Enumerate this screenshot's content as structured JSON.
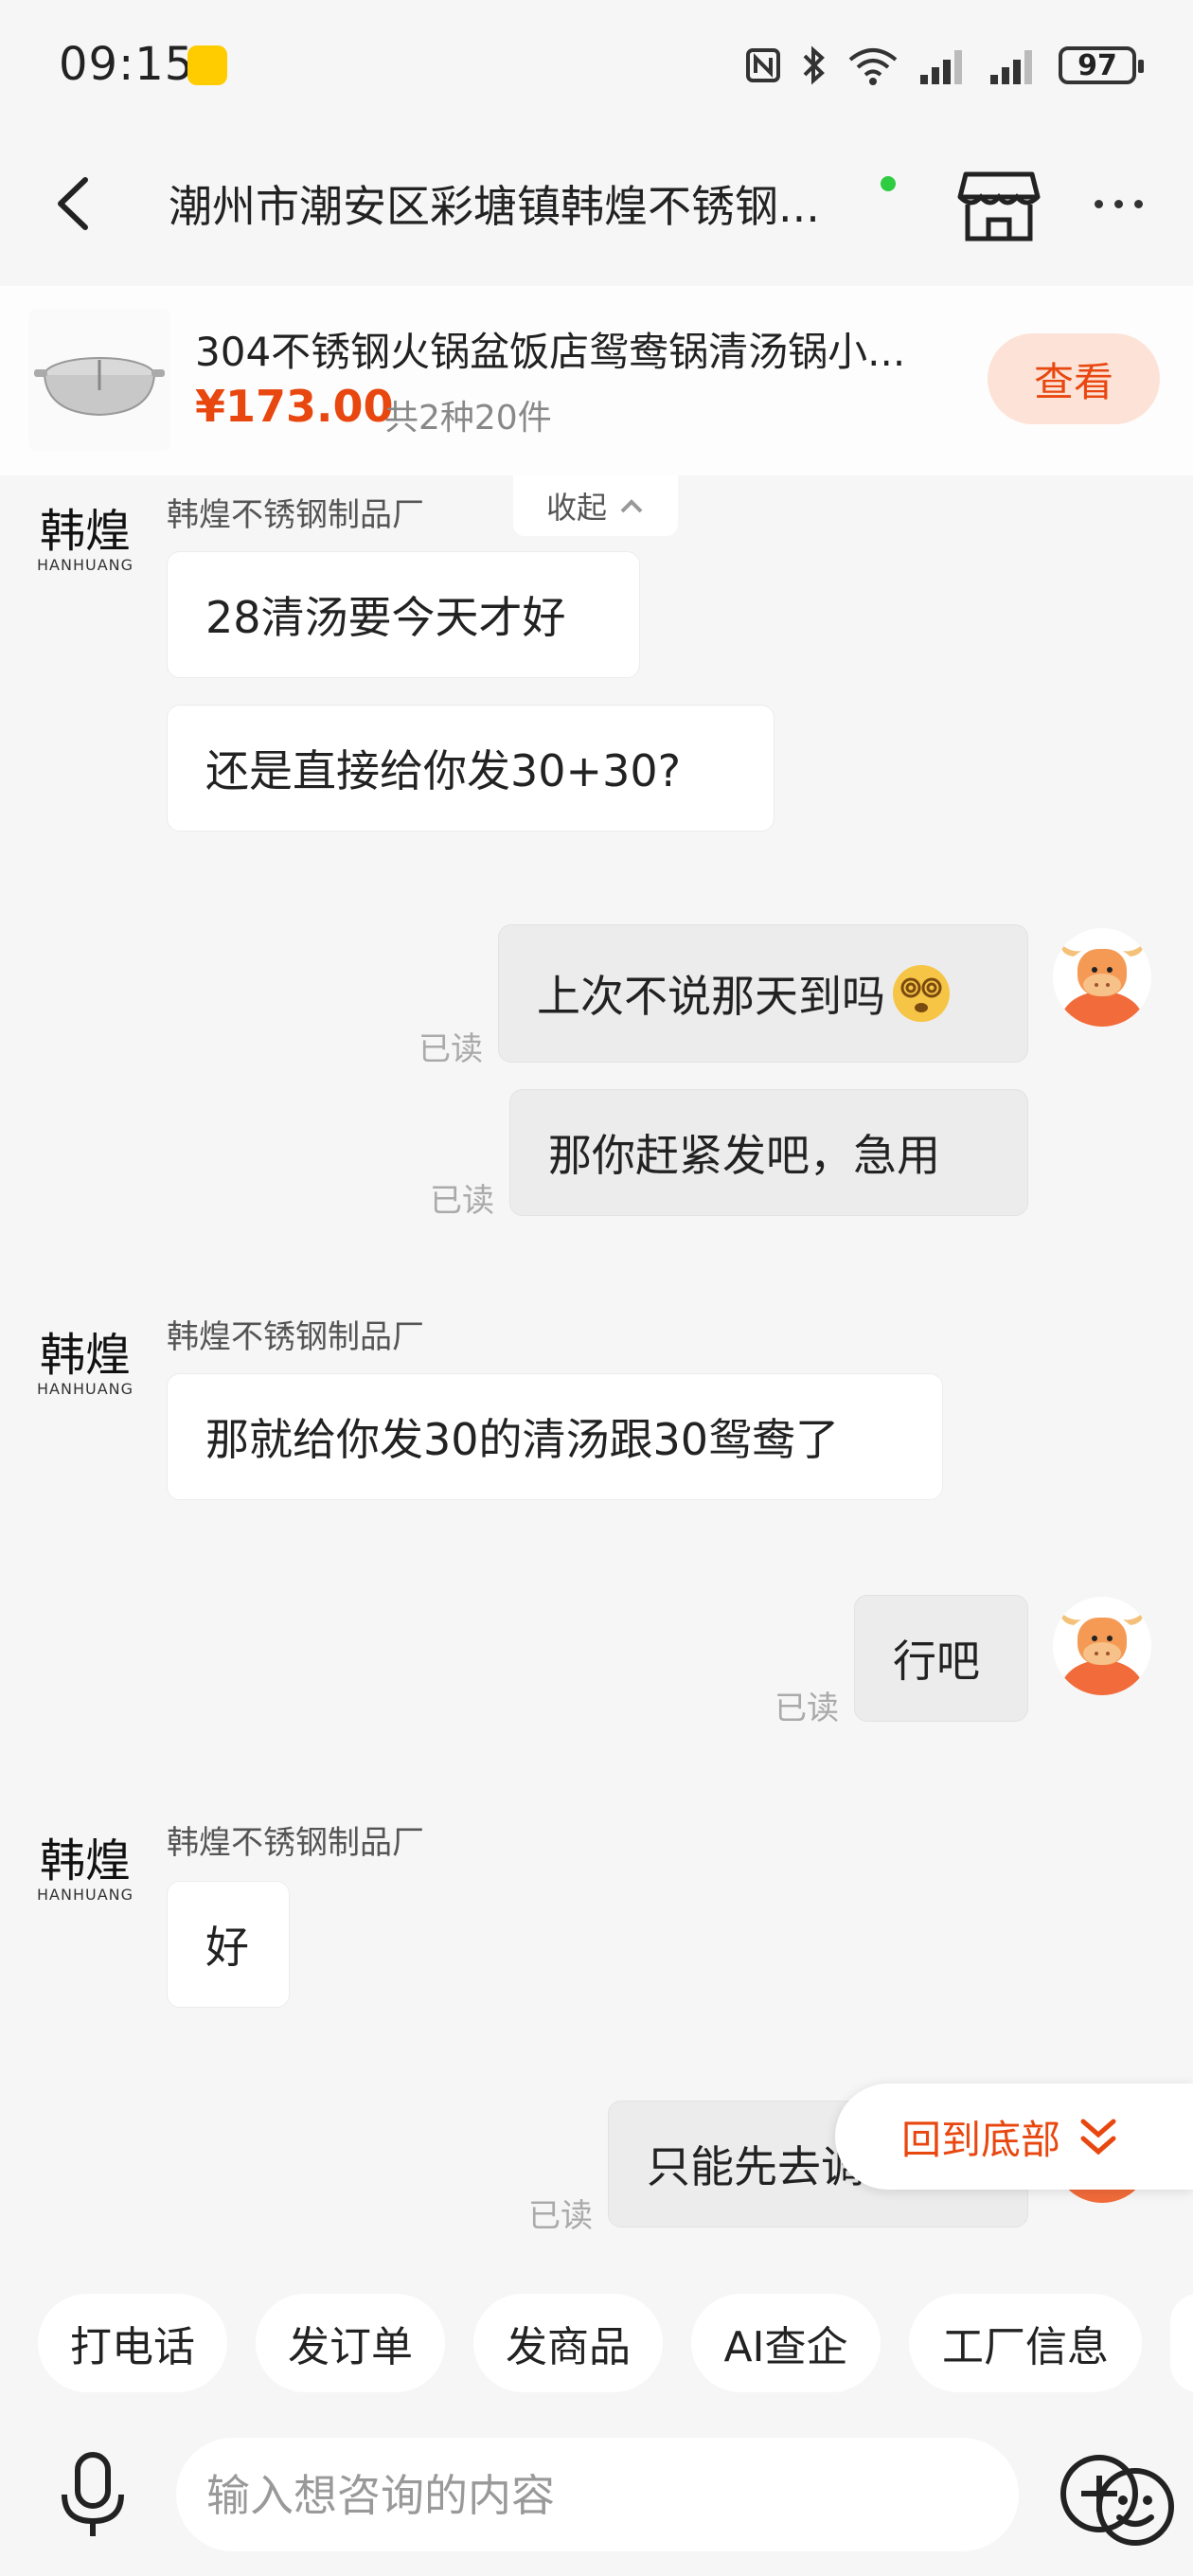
{
  "status": {
    "time": "09:15",
    "battery": "97"
  },
  "header": {
    "title": "潮州市潮安区彩塘镇韩煌不锈钢..."
  },
  "product": {
    "title": "304不锈钢火锅盆饭店鸳鸯锅清汤锅小...",
    "price": "¥173.00",
    "count": "共2种20件",
    "view_label": "查看"
  },
  "seller": {
    "name": "韩煌不锈钢制品厂",
    "avatar_text": "韩煌",
    "avatar_sub": "HANHUANG"
  },
  "collapse_label": "收起",
  "messages": [
    {
      "side": "left",
      "text": "28清汤要今天才好"
    },
    {
      "side": "left",
      "text": "还是直接给你发30+30?"
    },
    {
      "side": "right",
      "text": "上次不说那天到吗",
      "read": "已读"
    },
    {
      "side": "right",
      "text": "那你赶紧发吧，急用",
      "read": "已读"
    },
    {
      "side": "left",
      "text": "那就给你发30的清汤跟30鸳鸯了"
    },
    {
      "side": "right",
      "text": "行吧",
      "read": "已读"
    },
    {
      "side": "left",
      "text": "好"
    },
    {
      "side": "right",
      "text": "只能先去调货了",
      "read": "已读"
    }
  ],
  "back_to_bottom": "回到底部",
  "quick_actions": [
    "打电话",
    "发订单",
    "发商品",
    "AI查企",
    "工厂信息"
  ],
  "input": {
    "placeholder": "输入想咨询的内容"
  },
  "colors": {
    "accent": "#e8470f",
    "online": "#2ecc40",
    "chip_bg": "#ffffff"
  }
}
